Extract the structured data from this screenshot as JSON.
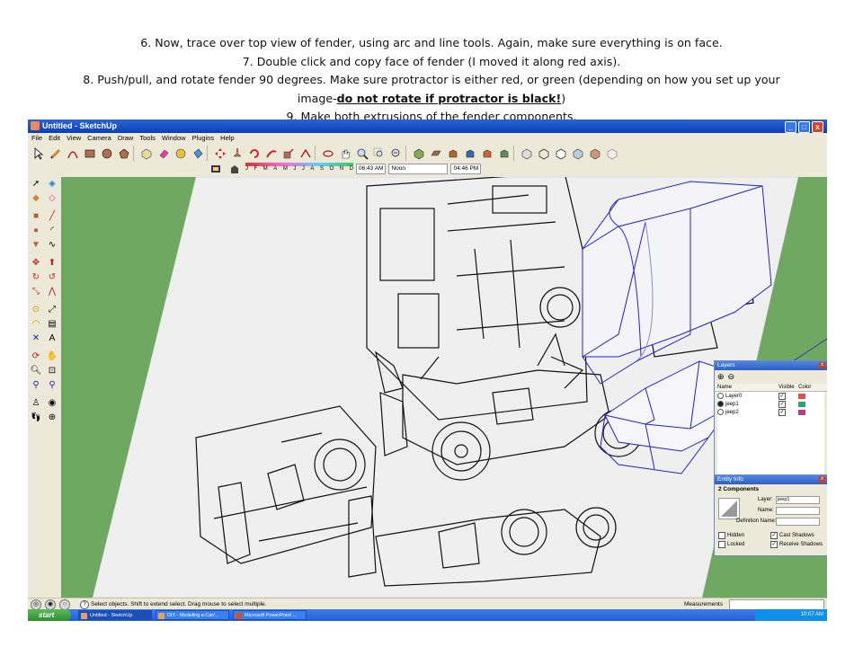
{
  "caption": {
    "line1": "6. Now, trace over top view of fender, using arc and line tools. Again, make sure everything is on face.",
    "line2": "7. Double click and copy face of fender (I moved it along red axis).",
    "line3": "8. Push/pull, and rotate fender 90 degrees. Make sure protractor is either red, or green (depending on how you set up your",
    "line4_prefix": "image-",
    "line4_emph": "do not rotate if protractor is black!",
    "line4_suffix": ")",
    "line5": "9. Make both extrusions of the fender components."
  },
  "window": {
    "title": "Untitled - SketchUp",
    "btn_min": "_",
    "btn_max": "□",
    "btn_close": "x"
  },
  "menu": [
    "File",
    "Edit",
    "View",
    "Camera",
    "Draw",
    "Tools",
    "Window",
    "Plugins",
    "Help"
  ],
  "shadow": {
    "months": [
      "J",
      "F",
      "M",
      "A",
      "M",
      "J",
      "J",
      "A",
      "S",
      "O",
      "N",
      "D"
    ],
    "time1": "06:43 AM",
    "noon": "Noon",
    "time2": "04:46 PM"
  },
  "layers": {
    "title": "Layers",
    "add": "⊕",
    "remove": "⊖",
    "headers": {
      "name": "Name",
      "visible": "Visible",
      "color": "Color"
    },
    "rows": [
      {
        "name": "Layer0",
        "active": false,
        "color": "#e84c4c"
      },
      {
        "name": "jeep1",
        "active": true,
        "color": "#28a86c"
      },
      {
        "name": "jeep2",
        "active": false,
        "color": "#c03a8a"
      }
    ],
    "check": "✓",
    "close": "x"
  },
  "entity": {
    "title": "Entity Info",
    "summary": "2 Components",
    "layer_label": "Layer:",
    "layer_value": "jeep1",
    "name_label": "Name:",
    "defname_label": "Definition Name:",
    "hidden": "Hidden",
    "locked": "Locked",
    "cast": "Cast Shadows",
    "receive": "Receive Shadows",
    "close": "x"
  },
  "status": {
    "message": "Select objects. Shift to extend select. Drag mouse to select multiple.",
    "measurements": "Measurements",
    "help": "?"
  },
  "taskbar": {
    "start": "start",
    "tasks": [
      "Untitled - SketchUp",
      "DIY - Modeling a Car/...",
      "Microsoft PowerPoint ..."
    ],
    "time": "10:07 AM"
  },
  "colors": {
    "ground": "#6fa860",
    "selection": "#2222cc",
    "titlebar": "#0b3fb6"
  }
}
